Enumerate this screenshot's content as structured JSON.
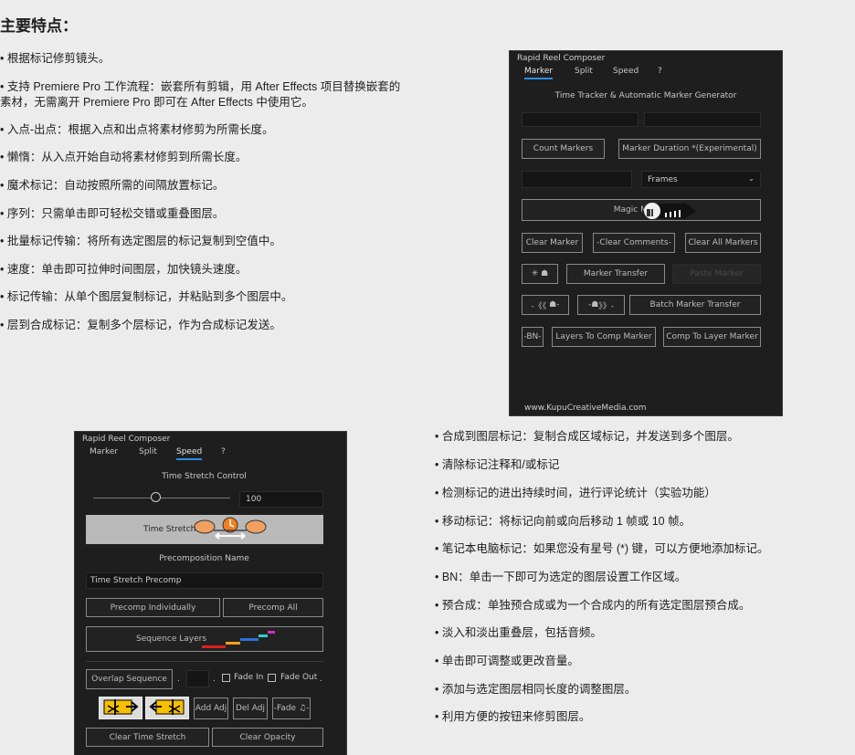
{
  "heading": "主要特点：",
  "features_left": [
    "根据标记修剪镜头。",
    "支持 Premiere Pro 工作流程：嵌套所有剪辑，用 After Effects 项目替换嵌套的",
    "素材，无需离开 Premiere Pro 即可在 After Effects 中使用它。",
    "入点-出点：根据入点和出点将素材修剪为所需长度。",
    "懒惰：从入点开始自动将素材修剪到所需长度。",
    "魔术标记：自动按照所需的间隔放置标记。",
    "序列：只需单击即可轻松交错或重叠图层。",
    "批量标记传输：将所有选定图层的标记复制到空值中。",
    "速度：单击即可拉伸时间图层，加快镜头速度。",
    "标记传输：从单个图层复制标记，并粘贴到多个图层中。",
    "层到合成标记：复制多个层标记，作为合成标记发送。"
  ],
  "features_right": [
    "合成到图层标记：复制合成区域标记，并发送到多个图层。",
    "清除标记注释和/或标记",
    "检测标记的进出持续时间，进行评论统计（实验功能）",
    "移动标记：将标记向前或向后移动 1 帧或 10 帧。",
    "笔记本电脑标记：如果您没有星号 (*) 键，可以方便地添加标记。",
    "BN：单击一下即可为选定的图层设置工作区域。",
    "预合成：单独预合成或为一个合成内的所有选定图层预合成。",
    "淡入和淡出重叠层，包括音频。",
    "单击即可调整或更改音量。",
    "添加与选定图层相同长度的调整图层。",
    "利用方便的按钮来修剪图层。"
  ],
  "panel_marker": {
    "title": "Rapid Reel Composer",
    "tabs": [
      "Marker",
      "Split",
      "Speed",
      "?"
    ],
    "heading": "Time Tracker & Automatic Marker Generator",
    "count_markers": "Count Markers",
    "marker_duration": "Marker Duration *(Experimental)",
    "frames_option": "Frames",
    "magic_marker": "Magic Marker",
    "clear_marker": "Clear Marker",
    "clear_comments": "-Clear Comments-",
    "clear_all_markers": "Clear All Markers",
    "marker_transfer": "Marker Transfer",
    "paste_marker": "Paste Marker",
    "shift_back": "-《《",
    "shift_fwd": "》》-",
    "batch_marker_transfer": "Batch Marker Transfer",
    "bn": "-BN-",
    "layers_to_comp": "Layers To Comp Marker",
    "comp_to_layer": "Comp To Layer Marker",
    "footer": "www.KupuCreativeMedia.com"
  },
  "panel_speed": {
    "title": "Rapid Reel Composer",
    "tabs": [
      "Marker",
      "Split",
      "Speed",
      "?"
    ],
    "time_stretch_control": "Time Stretch Control",
    "slider_value": "100",
    "slider_fraction": 0.45,
    "time_stretch": "Time Stretch",
    "precomp_name_label": "Precomposition Name",
    "precomp_name_value": "Time Stretch Precomp",
    "precomp_individually": "Precomp Individually",
    "precomp_all": "Precomp All",
    "sequence_layers": "Sequence Layers",
    "overlap_sequence": "Overlap Sequence",
    "dot": ".",
    "fade_in": "Fade In",
    "fade_out": "Fade Out",
    "add_adj": "Add Adj",
    "del_adj": "Del Adj",
    "fade_audio": "-Fade ♫-",
    "clear_time_stretch": "Clear Time Stretch",
    "clear_opacity": "Clear Opacity"
  }
}
